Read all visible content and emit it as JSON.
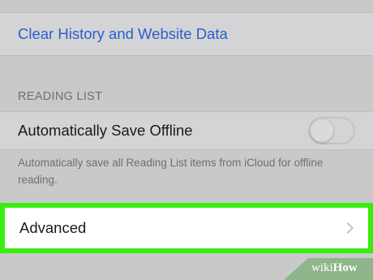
{
  "history_section": {
    "clear_label": "Clear History and Website Data"
  },
  "reading_list": {
    "header": "READING LIST",
    "auto_save_label": "Automatically Save Offline",
    "auto_save_enabled": false,
    "footnote": "Automatically save all Reading List items from iCloud for offline reading."
  },
  "advanced": {
    "label": "Advanced"
  },
  "watermark": {
    "prefix": "wiki",
    "suffix": "How"
  },
  "colors": {
    "highlight": "#37ee0f",
    "link": "#2b5fce",
    "watermark_bg": "#8fb58a"
  }
}
